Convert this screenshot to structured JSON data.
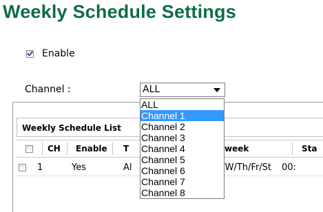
{
  "page": {
    "title": "Weekly Schedule Settings"
  },
  "enable": {
    "label": "Enable",
    "checked": true
  },
  "channel": {
    "label": "Channel :",
    "selected": "ALL",
    "options": [
      "ALL",
      "Channel 1",
      "Channel 2",
      "Channel 3",
      "Channel 4",
      "Channel 5",
      "Channel 6",
      "Channel 7",
      "Channel 8"
    ],
    "highlighted": "Channel 1"
  },
  "schedule_list": {
    "title": "Weekly Schedule List",
    "columns": [
      "CH",
      "Enable",
      "T",
      "week",
      "Sta"
    ],
    "rows": [
      {
        "ch": "1",
        "enable": "Yes",
        "t": "Al",
        "week": "u/W/Th/Fr/St",
        "start": "00:"
      }
    ]
  },
  "colors": {
    "title": "#0e6e44",
    "highlight": "#3399ff"
  }
}
